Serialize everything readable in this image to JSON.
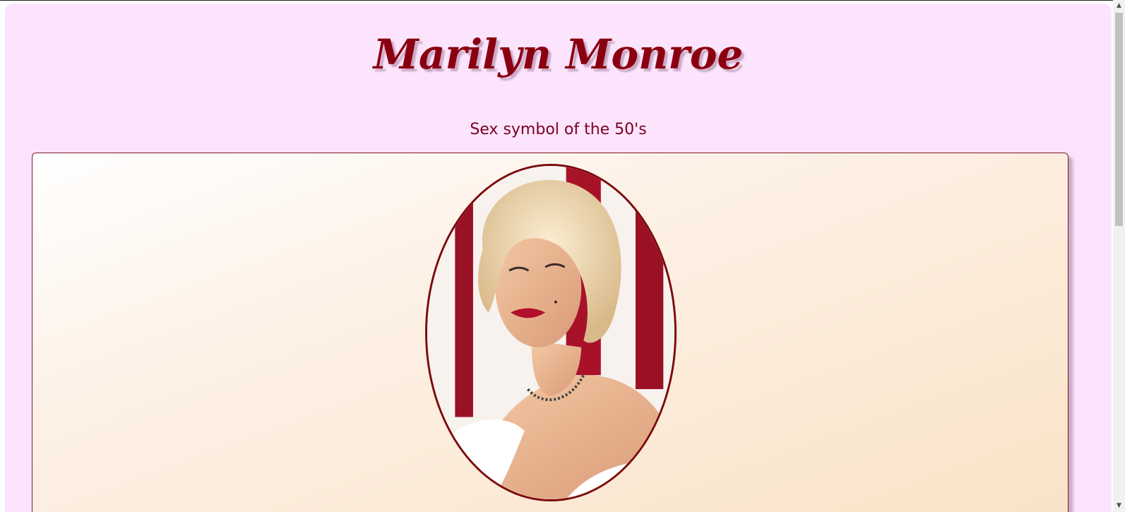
{
  "page": {
    "title": "Marilyn Monroe",
    "subtitle": "Sex symbol of the 50's"
  },
  "portrait": {
    "icon": "portrait-photo",
    "frame_color": "#7a0a0a"
  },
  "colors": {
    "title": "#8b0010",
    "subtitle": "#7a0020",
    "page_background": "#fce4fc",
    "panel_gradient_end": "#f9e2c6"
  },
  "scrollbar": {
    "up_icon": "chevron-up-icon",
    "down_icon": "chevron-down-icon"
  }
}
